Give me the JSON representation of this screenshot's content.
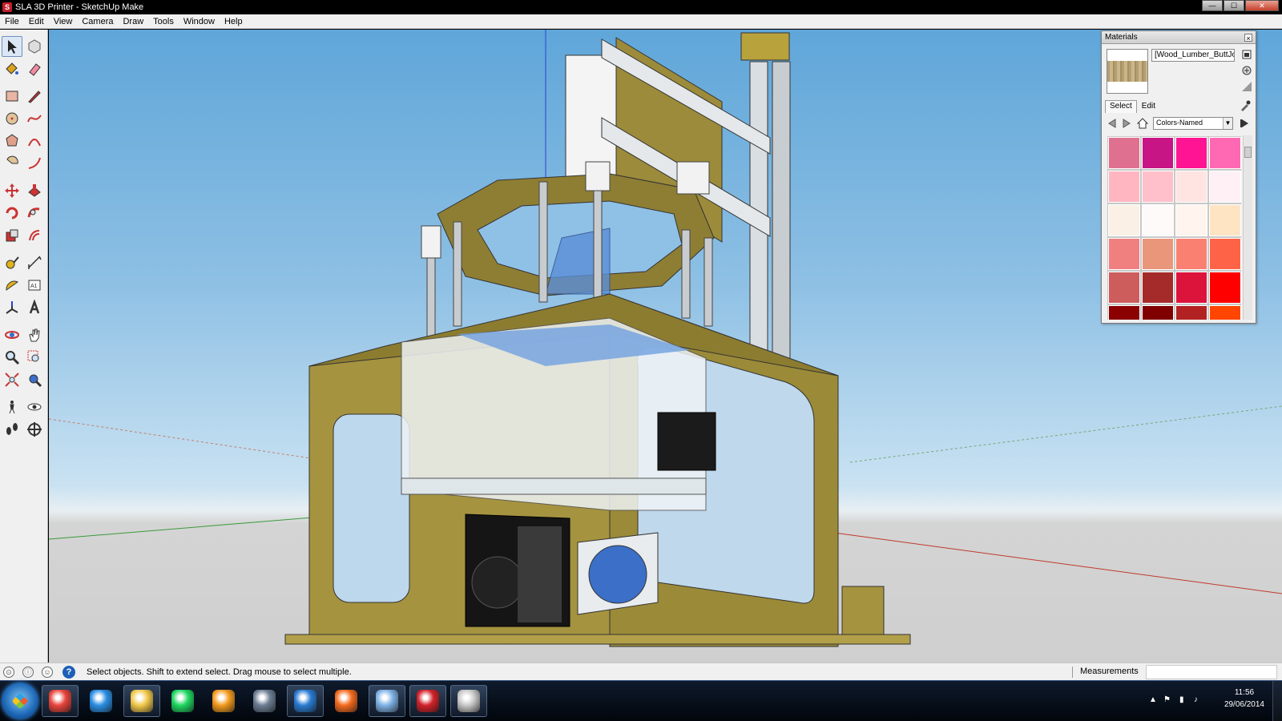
{
  "window": {
    "title": "SLA 3D Printer - SketchUp Make",
    "min_label": "—",
    "max_label": "☐",
    "close_label": "✕"
  },
  "menu": [
    "File",
    "Edit",
    "View",
    "Camera",
    "Draw",
    "Tools",
    "Window",
    "Help"
  ],
  "tools": [
    {
      "name": "select-tool",
      "icon": "arrow-icon",
      "active": true
    },
    {
      "name": "make-component-tool",
      "icon": "component-icon"
    },
    {
      "name": "paint-bucket-tool",
      "icon": "paint-bucket-icon"
    },
    {
      "name": "eraser-tool",
      "icon": "eraser-icon"
    },
    {
      "name": "rectangle-tool",
      "icon": "rectangle-icon"
    },
    {
      "name": "line-tool",
      "icon": "pencil-icon"
    },
    {
      "name": "circle-tool",
      "icon": "circle-icon"
    },
    {
      "name": "freehand-tool",
      "icon": "freehand-icon"
    },
    {
      "name": "polygon-tool",
      "icon": "polygon-icon"
    },
    {
      "name": "arc-tool",
      "icon": "arc-icon"
    },
    {
      "name": "pie-tool",
      "icon": "pie-icon"
    },
    {
      "name": "two-point-arc-tool",
      "icon": "arc2-icon"
    },
    {
      "name": "move-tool",
      "icon": "move-icon"
    },
    {
      "name": "push-pull-tool",
      "icon": "push-pull-icon"
    },
    {
      "name": "rotate-tool",
      "icon": "rotate-icon"
    },
    {
      "name": "follow-me-tool",
      "icon": "follow-me-icon"
    },
    {
      "name": "scale-tool",
      "icon": "scale-icon"
    },
    {
      "name": "offset-tool",
      "icon": "offset-icon"
    },
    {
      "name": "tape-measure-tool",
      "icon": "tape-measure-icon"
    },
    {
      "name": "dimension-tool",
      "icon": "dimension-icon"
    },
    {
      "name": "protractor-tool",
      "icon": "protractor-icon"
    },
    {
      "name": "text-tool",
      "icon": "text-icon"
    },
    {
      "name": "axes-tool",
      "icon": "axes-icon"
    },
    {
      "name": "3d-text-tool",
      "icon": "3d-text-icon"
    },
    {
      "name": "orbit-tool",
      "icon": "orbit-icon"
    },
    {
      "name": "pan-tool",
      "icon": "hand-icon"
    },
    {
      "name": "zoom-tool",
      "icon": "zoom-icon"
    },
    {
      "name": "zoom-window-tool",
      "icon": "zoom-window-icon"
    },
    {
      "name": "zoom-extents-tool",
      "icon": "zoom-extents-icon"
    },
    {
      "name": "previous-view-tool",
      "icon": "previous-view-icon"
    },
    {
      "name": "position-camera-tool",
      "icon": "position-camera-icon"
    },
    {
      "name": "look-around-tool",
      "icon": "eye-icon"
    },
    {
      "name": "walk-tool",
      "icon": "footsteps-icon"
    },
    {
      "name": "section-plane-tool",
      "icon": "section-plane-icon"
    }
  ],
  "materials": {
    "title": "Materials",
    "current_material": "[Wood_Lumber_ButtJoin",
    "tabs": [
      "Select",
      "Edit"
    ],
    "active_tab": "Select",
    "library": "Colors-Named",
    "swatch_colors": [
      "#e0708f",
      "#c71585",
      "#ff1493",
      "#ff69b4",
      "#ffb6c1",
      "#ffc0cb",
      "#ffe4e1",
      "#fff0f5",
      "#faf0e6",
      "#fffafa",
      "#fff5ee",
      "#ffe4c4",
      "#f08080",
      "#e9967a",
      "#fa8072",
      "#ff6347",
      "#cd5c5c",
      "#a52a2a",
      "#dc143c",
      "#ff0000",
      "#8b0000",
      "#800000",
      "#b22222",
      "#ff4500"
    ]
  },
  "status": {
    "message": "Select objects. Shift to extend select. Drag mouse to select multiple.",
    "measurements_label": "Measurements",
    "measurements_value": ""
  },
  "taskbar": {
    "apps": [
      {
        "name": "chrome-icon",
        "color": "#e8453c",
        "running": true
      },
      {
        "name": "internet-explorer-icon",
        "color": "#2b8ee3",
        "running": false
      },
      {
        "name": "file-explorer-icon",
        "color": "#f2c94c",
        "running": true
      },
      {
        "name": "spotify-icon",
        "color": "#1ed760",
        "running": false
      },
      {
        "name": "media-player-icon",
        "color": "#f39a1e",
        "running": false
      },
      {
        "name": "steam-icon",
        "color": "#6d7e93",
        "running": false
      },
      {
        "name": "uplay-icon",
        "color": "#2a7cd4",
        "running": true
      },
      {
        "name": "origin-icon",
        "color": "#f46b1e",
        "running": false
      },
      {
        "name": "settings-app-icon",
        "color": "#7fb2e6",
        "running": true
      },
      {
        "name": "sketchup-icon",
        "color": "#d2232a",
        "running": true
      },
      {
        "name": "paint-app-icon",
        "color": "#c8c8c8",
        "running": true
      }
    ],
    "time": "11:56",
    "date": "29/06/2014"
  }
}
